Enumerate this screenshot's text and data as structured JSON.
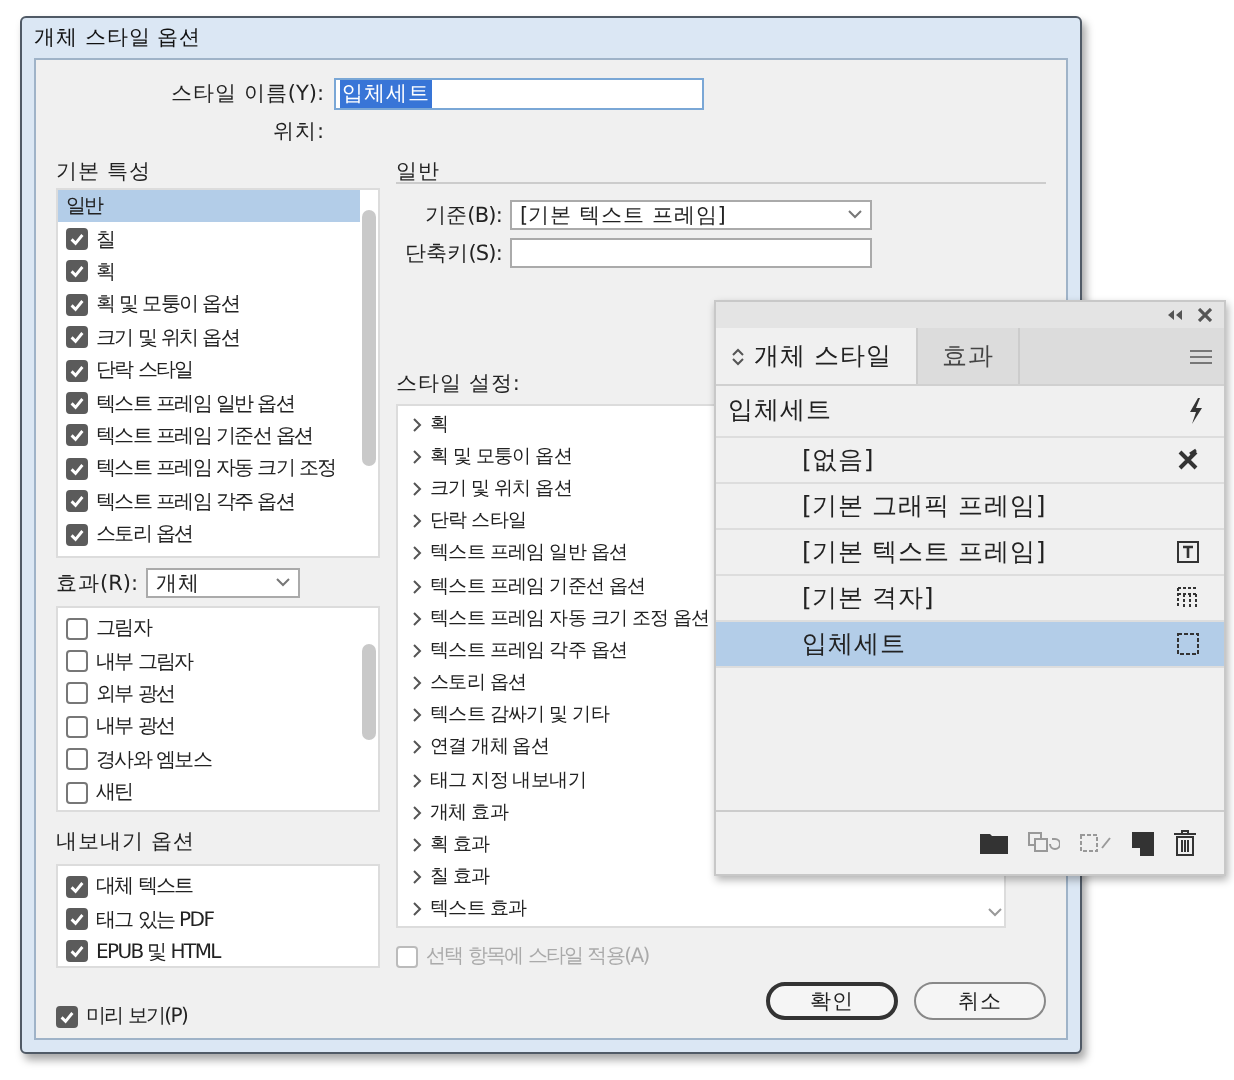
{
  "dialog": {
    "title": "개체 스타일 옵션"
  },
  "style_name": {
    "label": "스타일 이름(Y):",
    "value": "입체세트",
    "selected": true
  },
  "location": {
    "label": "위치:"
  },
  "basic_attributes": {
    "heading": "기본 특성",
    "items": [
      {
        "label": "일반",
        "kind": "header",
        "selected": true
      },
      {
        "label": "칠",
        "kind": "check",
        "checked": true,
        "selected": false
      },
      {
        "label": "획",
        "kind": "check",
        "checked": true,
        "selected": false
      },
      {
        "label": "획 및 모퉁이 옵션",
        "kind": "check",
        "checked": true,
        "selected": false
      },
      {
        "label": "크기 및 위치 옵션",
        "kind": "check",
        "checked": true,
        "selected": false
      },
      {
        "label": "단락 스타일",
        "kind": "check",
        "checked": true,
        "selected": false
      },
      {
        "label": "텍스트 프레임 일반 옵션",
        "kind": "check",
        "checked": true,
        "selected": false
      },
      {
        "label": "텍스트 프레임 기준선 옵션",
        "kind": "check",
        "checked": true,
        "selected": false
      },
      {
        "label": "텍스트 프레임 자동 크기 조정",
        "kind": "check",
        "checked": true,
        "selected": false
      },
      {
        "label": "텍스트 프레임 각주 옵션",
        "kind": "check",
        "checked": true,
        "selected": false
      },
      {
        "label": "스토리 옵션",
        "kind": "check",
        "checked": true,
        "selected": false
      }
    ]
  },
  "effects": {
    "label": "효과(R):",
    "dropdown": "개체",
    "items": [
      {
        "label": "그림자",
        "checked": false
      },
      {
        "label": "내부 그림자",
        "checked": false
      },
      {
        "label": "외부 광선",
        "checked": false
      },
      {
        "label": "내부 광선",
        "checked": false
      },
      {
        "label": "경사와 엠보스",
        "checked": false
      },
      {
        "label": "새틴",
        "checked": false
      }
    ]
  },
  "export_options": {
    "heading": "내보내기 옵션",
    "items": [
      {
        "label": "대체 텍스트",
        "checked": true
      },
      {
        "label": "태그 있는 PDF",
        "checked": true
      },
      {
        "label": "EPUB 및 HTML",
        "checked": true
      }
    ]
  },
  "preview": {
    "label": "미리 보기(P)",
    "checked": true
  },
  "general": {
    "heading": "일반",
    "based_on": {
      "label": "기준(B):",
      "value": "[기본 텍스트 프레임]"
    },
    "shortcut": {
      "label": "단축키(S):"
    }
  },
  "style_settings": {
    "heading": "스타일 설정:",
    "items": [
      "획",
      "획 및 모퉁이 옵션",
      "크기 및 위치 옵션",
      "단락 스타일",
      "텍스트 프레임 일반 옵션",
      "텍스트 프레임 기준선 옵션",
      "텍스트 프레임 자동 크기 조정 옵션",
      "텍스트 프레임 각주 옵션",
      "스토리 옵션",
      "텍스트 감싸기 및 기타",
      "연결 개체 옵션",
      "태그 지정 내보내기",
      "개체 효과",
      "획 효과",
      "칠 효과",
      "텍스트 효과"
    ]
  },
  "apply_to_selection": {
    "label": "선택 항목에 스타일 적용(A)",
    "checked": false,
    "disabled": true
  },
  "buttons": [
    {
      "label": "확인",
      "default": true
    },
    {
      "label": "취소",
      "default": false
    }
  ],
  "panel": {
    "tabs": [
      {
        "label": "개체 스타일",
        "selected": true
      },
      {
        "label": "효과",
        "selected": false
      }
    ],
    "current_style": "입체세트",
    "styles": [
      {
        "label": "[없음]",
        "kind": "none",
        "selected": false
      },
      {
        "label": "[기본 그래픽 프레임]",
        "kind": "graphic",
        "selected": false
      },
      {
        "label": "[기본 텍스트 프레임]",
        "kind": "text",
        "selected": false
      },
      {
        "label": "[기본 격자]",
        "kind": "grid",
        "selected": false
      },
      {
        "label": "입체세트",
        "kind": "custom",
        "selected": true
      }
    ]
  }
}
